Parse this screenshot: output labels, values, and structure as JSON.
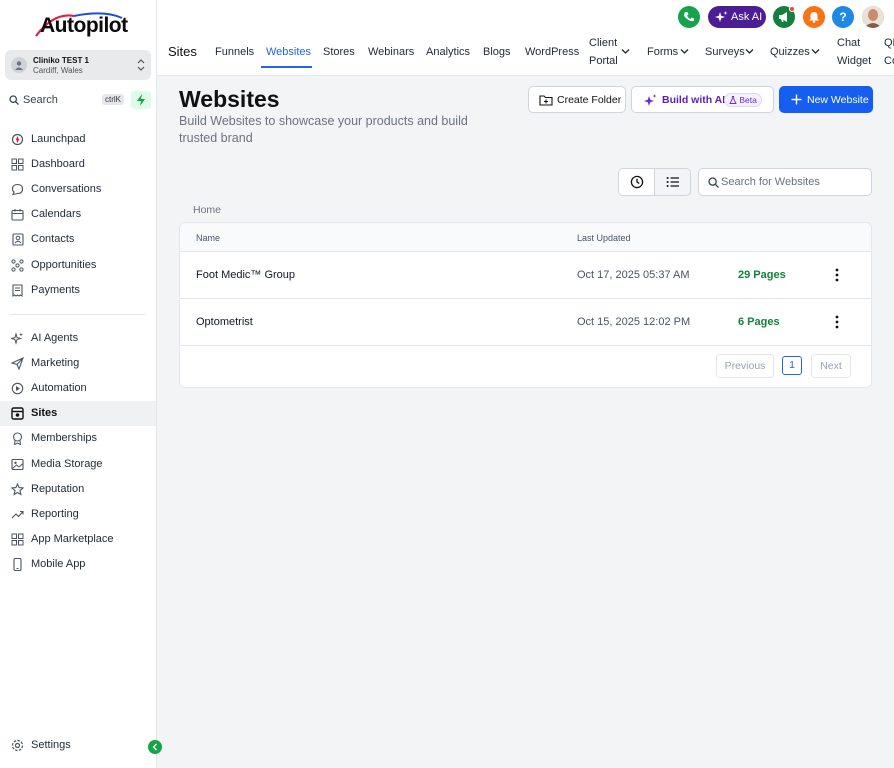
{
  "brand": {
    "logo_text": "Autopilot",
    "accent": "#155eef",
    "green": "#16a34a"
  },
  "account": {
    "name": "Cliniko TEST 1",
    "location": "Cardiff, Wales"
  },
  "search": {
    "label": "Search",
    "shortcut": "ctrlK"
  },
  "sidebar": {
    "items": [
      {
        "label": "Launchpad",
        "icon": "rocket-icon"
      },
      {
        "label": "Dashboard",
        "icon": "grid-icon"
      },
      {
        "label": "Conversations",
        "icon": "chat-icon"
      },
      {
        "label": "Calendars",
        "icon": "calendar-icon"
      },
      {
        "label": "Contacts",
        "icon": "contacts-icon"
      },
      {
        "label": "Opportunities",
        "icon": "opportunities-icon"
      },
      {
        "label": "Payments",
        "icon": "receipt-icon"
      }
    ],
    "items2": [
      {
        "label": "AI Agents",
        "icon": "sparkle-icon"
      },
      {
        "label": "Marketing",
        "icon": "send-icon"
      },
      {
        "label": "Automation",
        "icon": "automation-icon"
      },
      {
        "label": "Sites",
        "icon": "sites-icon",
        "active": true
      },
      {
        "label": "Memberships",
        "icon": "award-icon"
      },
      {
        "label": "Media Storage",
        "icon": "image-icon"
      },
      {
        "label": "Reputation",
        "icon": "star-icon"
      },
      {
        "label": "Reporting",
        "icon": "trend-icon"
      },
      {
        "label": "App Marketplace",
        "icon": "apps-icon"
      },
      {
        "label": "Mobile App",
        "icon": "phone-icon"
      }
    ],
    "settings": "Settings"
  },
  "topbar": {
    "section": "Sites",
    "tabs": [
      "Funnels",
      "Websites",
      "Stores",
      "Webinars",
      "Analytics",
      "Blogs",
      "WordPress"
    ],
    "client_portal": [
      "Client",
      "Portal"
    ],
    "forms": "Forms",
    "surveys": "Surveys",
    "quizzes": "Quizzes",
    "chat_widget": [
      "Chat",
      "Widget"
    ],
    "qr_codes": [
      "QR",
      "Co"
    ],
    "ask_ai": "Ask AI",
    "help": "?"
  },
  "page": {
    "title": "Websites",
    "subtitle": "Build Websites to showcase your products and build trusted brand",
    "create_folder": "Create Folder",
    "build_ai": "Build with AI",
    "beta": "Beta",
    "new_website": "New Website",
    "search_placeholder": "Search for Websites",
    "breadcrumb": "Home"
  },
  "table": {
    "headers": {
      "name": "Name",
      "updated": "Last Updated"
    },
    "rows": [
      {
        "name": "Foot Medic™ Group",
        "updated": "Oct 17, 2025 05:37 AM",
        "pages": "29 Pages"
      },
      {
        "name": "Optometrist",
        "updated": "Oct 15, 2025 12:02 PM",
        "pages": "6 Pages"
      }
    ],
    "pager": {
      "prev": "Previous",
      "page": "1",
      "next": "Next"
    }
  }
}
